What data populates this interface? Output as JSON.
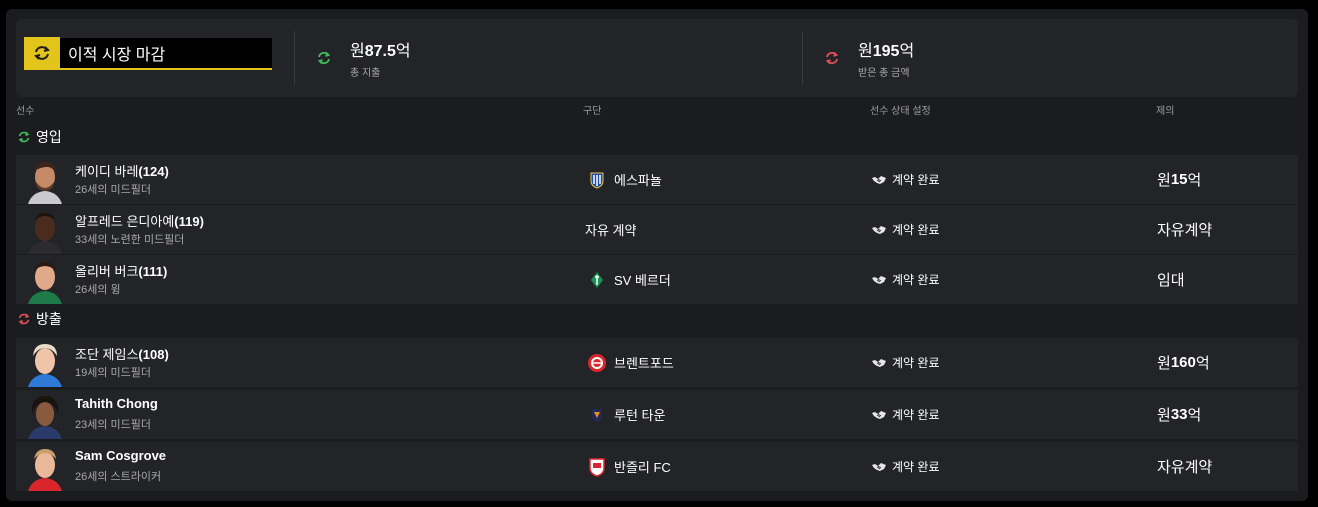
{
  "summary": {
    "title": "이적 시장 마감",
    "spent": {
      "currency": "원",
      "amount": "87.5",
      "unit": "억",
      "label": "총 지출"
    },
    "received": {
      "currency": "원",
      "amount": "195",
      "unit": "억",
      "label": "받은 총 금액"
    }
  },
  "columns": {
    "player": "선수",
    "club": "구단",
    "status": "선수 상태 설정",
    "offer": "제의"
  },
  "colors": {
    "accent": "#e2c41a",
    "in": "#3fbf5a",
    "out": "#e2505a",
    "row": "#232428"
  },
  "sections": [
    {
      "label": "영입",
      "icon": "incoming-arrows-icon",
      "rows": [
        {
          "name": "케이디 바레",
          "rating": "(124)",
          "desc": "26세의 미드필더",
          "club": "에스파뇰",
          "crest": "espanyol-crest-icon",
          "status": "계약 완료",
          "offer_cur": "원",
          "offer_amt": "15",
          "offer_unit": "억",
          "offer_text": ""
        },
        {
          "name": "알프레드 은디아예",
          "rating": "(119)",
          "desc": "33세의 노련한 미드필더",
          "club": "자유 계약",
          "crest": "",
          "status": "계약 완료",
          "offer_cur": "",
          "offer_amt": "",
          "offer_unit": "",
          "offer_text": "자유계약"
        },
        {
          "name": "올리버 버크",
          "rating": "(111)",
          "desc": "26세의 윙",
          "club": "SV 베르더",
          "crest": "werder-crest-icon",
          "status": "계약 완료",
          "offer_cur": "",
          "offer_amt": "",
          "offer_unit": "",
          "offer_text": "임대"
        }
      ]
    },
    {
      "label": "방출",
      "icon": "outgoing-arrows-icon",
      "rows": [
        {
          "name": "조단 제임스",
          "rating": "(108)",
          "desc": "19세의 미드필더",
          "club": "브렌트포드",
          "crest": "brentford-crest-icon",
          "status": "계약 완료",
          "offer_cur": "원",
          "offer_amt": "160",
          "offer_unit": "억",
          "offer_text": ""
        },
        {
          "name": "Tahith Chong",
          "rating": "",
          "desc": "23세의 미드필더",
          "club": "루턴 타운",
          "crest": "luton-crest-icon",
          "status": "계약 완료",
          "offer_cur": "원",
          "offer_amt": "33",
          "offer_unit": "억",
          "offer_text": ""
        },
        {
          "name": "Sam Cosgrove",
          "rating": "",
          "desc": "26세의 스트라이커",
          "club": "반즐리 FC",
          "crest": "barnsley-crest-icon",
          "status": "계약 완료",
          "offer_cur": "",
          "offer_amt": "",
          "offer_unit": "",
          "offer_text": "자유계약"
        }
      ]
    }
  ]
}
